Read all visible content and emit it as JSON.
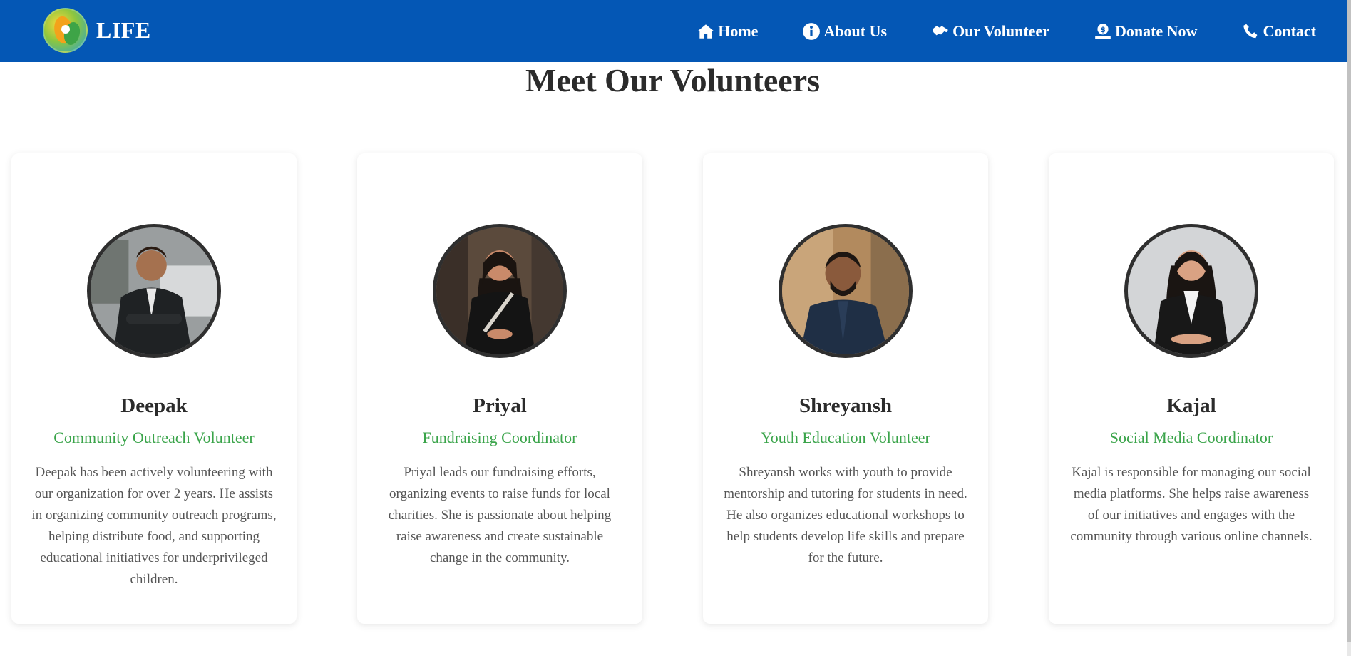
{
  "brand": {
    "name": "LIFE"
  },
  "nav": [
    {
      "label": "Home",
      "icon": "home-icon"
    },
    {
      "label": "About Us",
      "icon": "info-icon"
    },
    {
      "label": "Our Volunteer",
      "icon": "handshake-icon"
    },
    {
      "label": "Donate Now",
      "icon": "donate-icon"
    },
    {
      "label": "Contact",
      "icon": "phone-icon"
    }
  ],
  "colors": {
    "navbar": "#0457b5",
    "role_text": "#3aa44a",
    "heading": "#2b2b2b"
  },
  "page": {
    "title": "Meet Our Volunteers"
  },
  "volunteers": [
    {
      "name": "Deepak",
      "role": "Community Outreach Volunteer",
      "description": "Deepak has been actively volunteering with our organization for over 2 years. He assists in organizing community outreach programs, helping distribute food, and supporting educational initiatives for underprivileged children."
    },
    {
      "name": "Priyal",
      "role": "Fundraising Coordinator",
      "description": "Priyal leads our fundraising efforts, organizing events to raise funds for local charities. She is passionate about helping raise awareness and create sustainable change in the community."
    },
    {
      "name": "Shreyansh",
      "role": "Youth Education Volunteer",
      "description": "Shreyansh works with youth to provide mentorship and tutoring for students in need. He also organizes educational workshops to help students develop life skills and prepare for the future."
    },
    {
      "name": "Kajal",
      "role": "Social Media Coordinator",
      "description": "Kajal is responsible for managing our social media platforms. She helps raise awareness of our initiatives and engages with the community through various online channels."
    }
  ]
}
